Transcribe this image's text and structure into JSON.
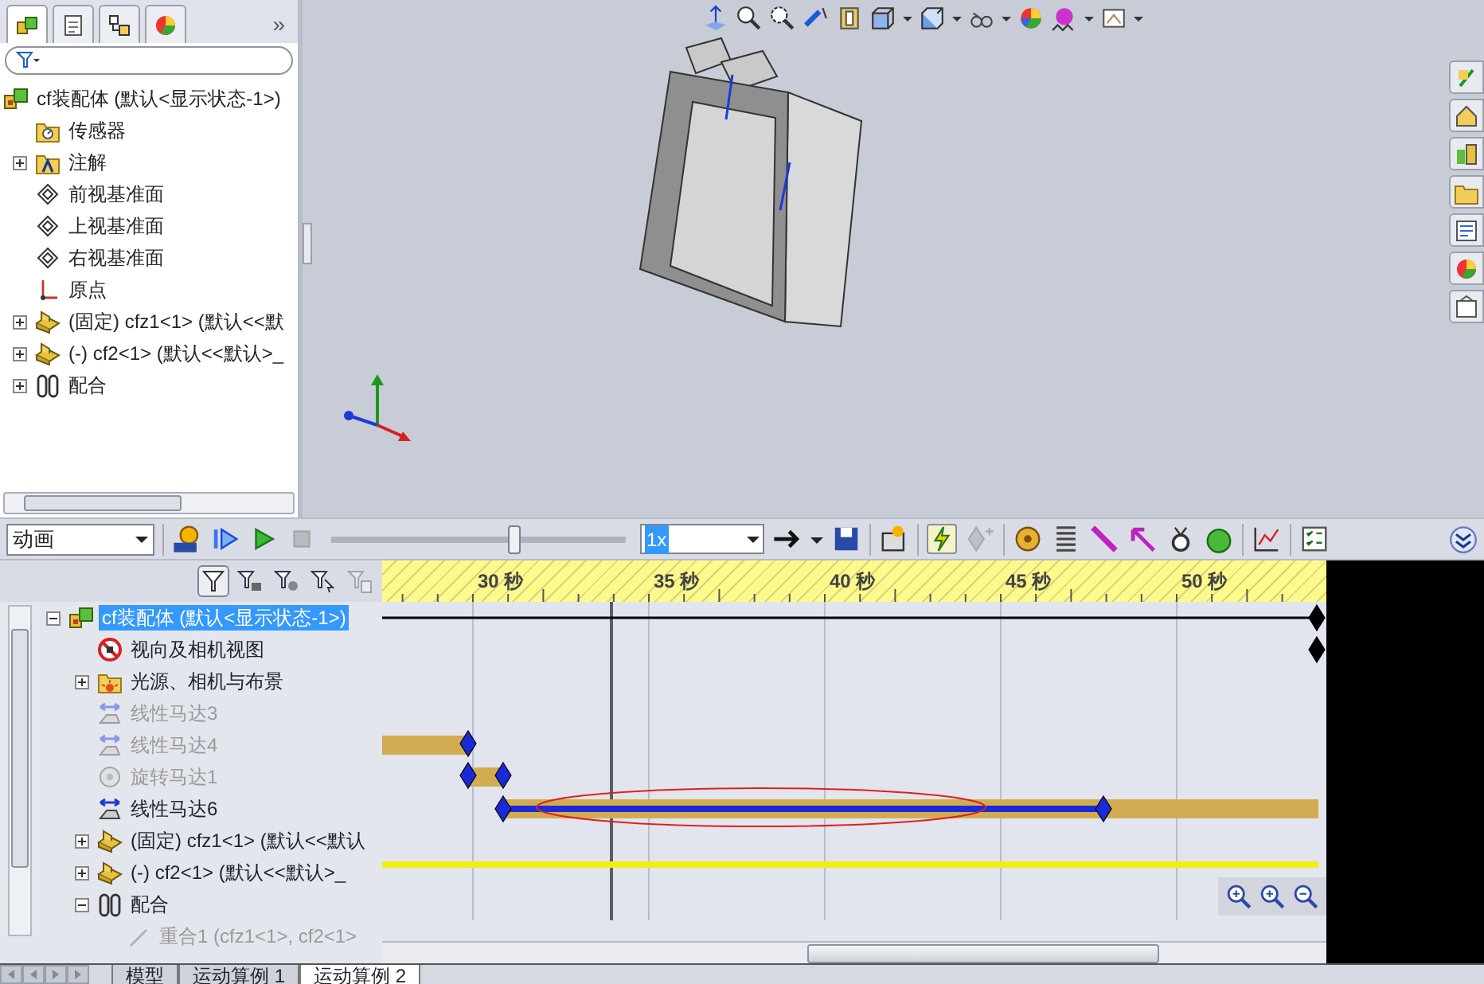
{
  "feature_panel": {
    "tabs": [
      {
        "kind": "feature-manager",
        "selected": true
      },
      {
        "kind": "property-manager",
        "selected": false
      },
      {
        "kind": "configuration-manager",
        "selected": false
      },
      {
        "kind": "display-manager",
        "selected": false
      }
    ],
    "more": "»",
    "tree": {
      "text": "cf装配体  (默认<显示状态-1>)",
      "kind": "assembly",
      "children": [
        {
          "text": "传感器",
          "kind": "sensor-folder"
        },
        {
          "text": "注解",
          "kind": "annotation-folder",
          "expanded": false
        },
        {
          "text": "前视基准面",
          "kind": "plane"
        },
        {
          "text": "上视基准面",
          "kind": "plane"
        },
        {
          "text": "右视基准面",
          "kind": "plane"
        },
        {
          "text": "原点",
          "kind": "origin"
        },
        {
          "text": "(固定) cfz1<1> (默认<<默",
          "kind": "part",
          "expanded": false
        },
        {
          "text": "(-) cf2<1> (默认<<默认>_",
          "kind": "part",
          "expanded": false
        },
        {
          "text": "配合",
          "kind": "mate",
          "expanded": false
        }
      ]
    }
  },
  "motion_toolbar": {
    "study_type": "动画",
    "speed": "1x",
    "timebar": {
      "level": 0.62
    },
    "stop_disabled": true,
    "autokey_on": true,
    "add_key_disabled": true
  },
  "motion_tree": {
    "filters": [
      {
        "kind": "filter",
        "on": true,
        "disabled": false
      },
      {
        "kind": "filter-animated",
        "on": false,
        "disabled": false
      },
      {
        "kind": "filter-driving",
        "on": false,
        "disabled": false
      },
      {
        "kind": "filter-selected",
        "on": false,
        "disabled": false
      },
      {
        "kind": "filter-results",
        "on": false,
        "disabled": true
      }
    ],
    "tree": {
      "text": "cf装配体  (默认<显示状态-1>)",
      "kind": "assembly",
      "expanded": true,
      "disabled": false,
      "selected": true,
      "children": [
        {
          "text": "视向及相机视图",
          "kind": "no-view",
          "disabled": false,
          "selected": false
        },
        {
          "text": "光源、相机与布景",
          "kind": "light-folder",
          "expanded": false,
          "disabled": false,
          "selected": false
        },
        {
          "text": "线性马达3",
          "kind": "linear-motor",
          "disabled": true,
          "selected": false
        },
        {
          "text": "线性马达4",
          "kind": "linear-motor",
          "disabled": true,
          "selected": false
        },
        {
          "text": "旋转马达1",
          "kind": "rotary-motor",
          "disabled": true,
          "selected": false
        },
        {
          "text": "线性马达6",
          "kind": "linear-motor",
          "disabled": false,
          "selected": false
        },
        {
          "text": "(固定) cfz1<1> (默认<<默认",
          "kind": "part",
          "expanded": false,
          "disabled": false,
          "selected": false
        },
        {
          "text": "(-) cf2<1> (默认<<默认>_",
          "kind": "part",
          "expanded": false,
          "disabled": false,
          "selected": false
        },
        {
          "text": "配合",
          "kind": "mate",
          "expanded": true,
          "disabled": false,
          "selected": false,
          "children": [
            {
              "text": "重合1 (cfz1<1>, cf2<1>",
              "kind": "mate-line",
              "disabled": true,
              "selected": false
            }
          ]
        }
      ]
    }
  },
  "timeline": {
    "ruler": [
      "30 秒",
      "35 秒",
      "40 秒",
      "45 秒",
      "50 秒"
    ]
  },
  "study_tabs": [
    {
      "label": "模型",
      "selected": false
    },
    {
      "label": "运动算例 1",
      "selected": false
    },
    {
      "label": "运动算例 2",
      "selected": true
    }
  ]
}
